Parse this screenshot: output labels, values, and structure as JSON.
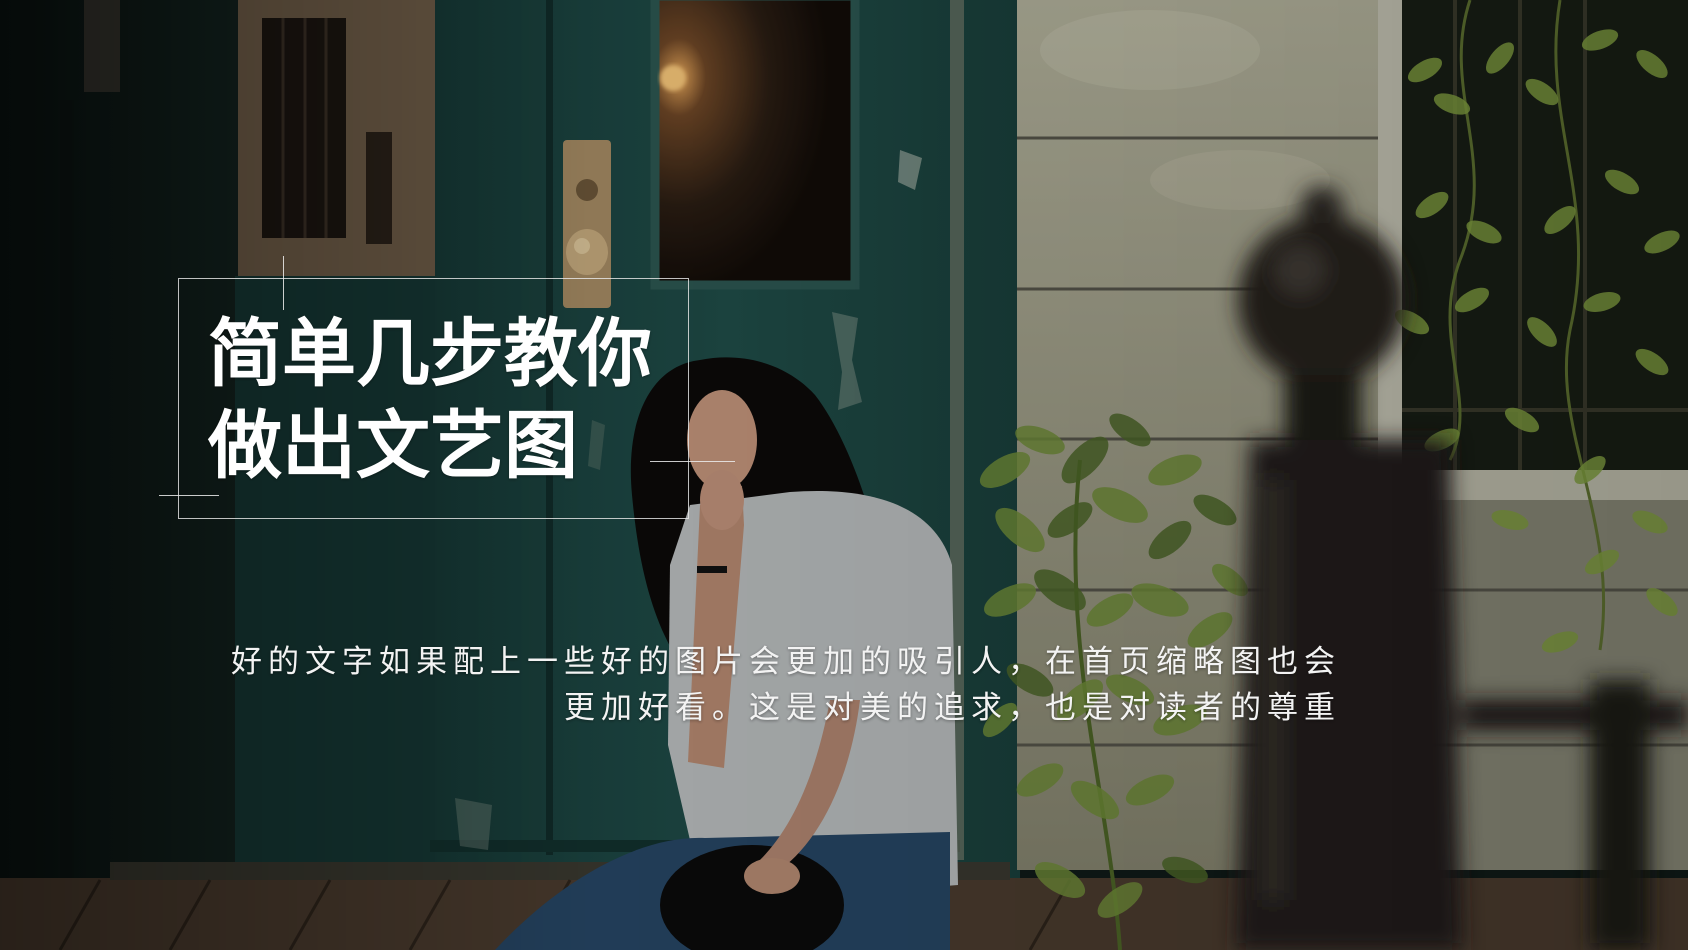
{
  "slide": {
    "title_line1": "简单几步教你",
    "title_line2": "做出文艺图",
    "subtitle_line1": "好的文字如果配上一些好的图片会更加的吸引人，在首页缩略图也会",
    "subtitle_line2": "更加好看。这是对美的追求，也是对读者的尊重"
  },
  "colors": {
    "text": "#ffffff",
    "frame_line": "#e8e8e8",
    "door_teal": "#1f4c48",
    "siding": "#a9a893",
    "foliage": "#7f9c40"
  }
}
